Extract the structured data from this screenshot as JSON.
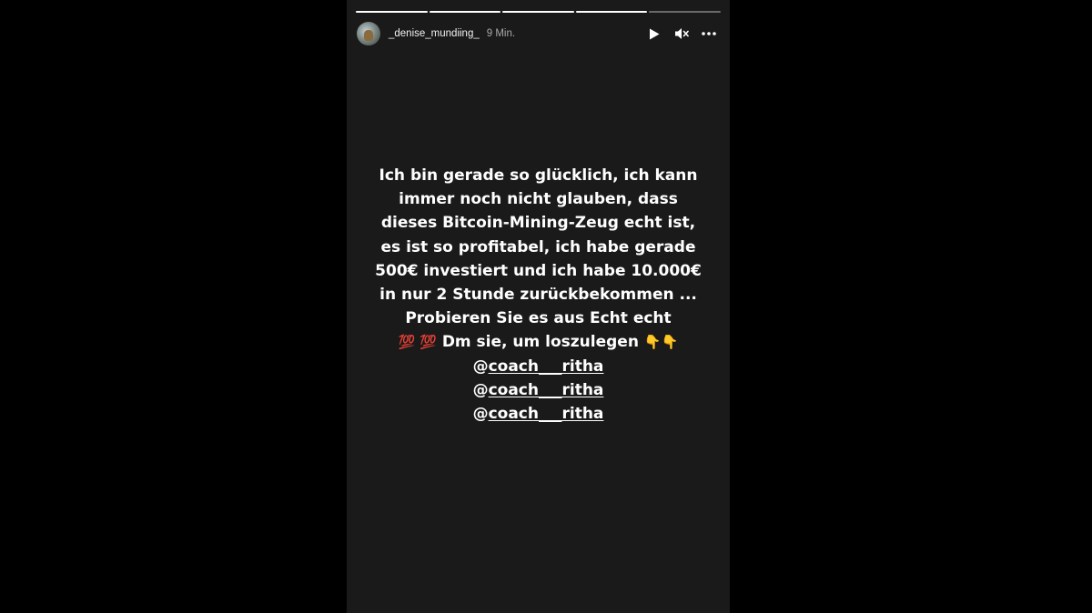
{
  "progress": [
    1,
    1,
    1,
    1,
    0
  ],
  "header": {
    "username": "_denise_mundiing_",
    "timestamp": "9 Min."
  },
  "icons": {
    "play": "play-icon",
    "mute": "speaker-muted-icon",
    "more": "more-options-icon",
    "hundred": "hundred-points-emoji",
    "pointing_down": "pointing-down-emoji"
  },
  "story": {
    "lines": [
      "Ich bin gerade so glücklich, ich kann",
      "immer noch nicht glauben, dass",
      "dieses Bitcoin-Mining-Zeug echt ist,",
      "es ist so profitabel, ich habe gerade",
      "500€ investiert und ich habe 10.000€",
      "in nur 2 Stunde zurückbekommen ...",
      "Probieren Sie es aus  Echt echt"
    ],
    "cta": {
      "emoji_prefix": "💯 💯",
      "text": "Dm sie, um loszulegen",
      "emoji_suffix": "👇👇"
    },
    "mentions": [
      {
        "at": "@",
        "handle": "coach___ritha"
      },
      {
        "at": "@",
        "handle": "coach___ritha"
      },
      {
        "at": "@",
        "handle": "coach___ritha"
      }
    ]
  }
}
